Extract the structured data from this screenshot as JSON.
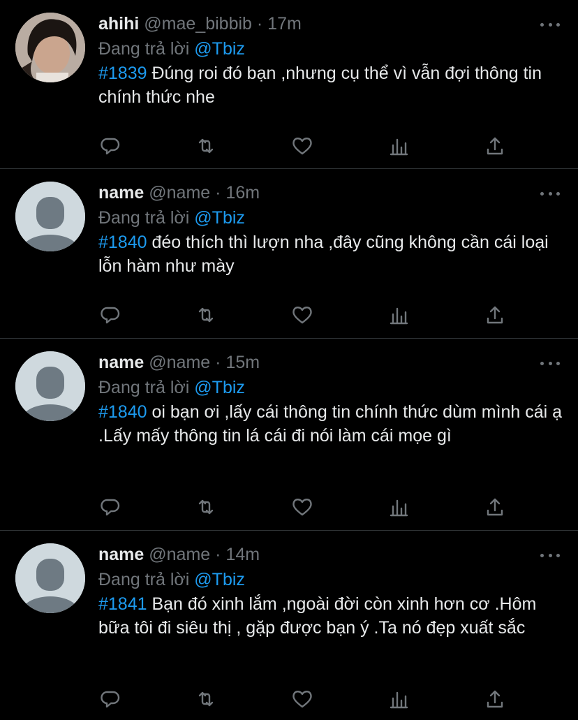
{
  "colors": {
    "background": "#000000",
    "text": "#e7e9ea",
    "muted": "#71767b",
    "accent": "#1d9bf0",
    "divider": "#2f3336"
  },
  "tweets": [
    {
      "name": "ahihi",
      "handle": "@mae_bibbib",
      "separator": "·",
      "time": "17m",
      "replying_prefix": "Đang trả lời",
      "replying_to": "@Tbiz",
      "hashtag": "#1839",
      "text": " Đúng roi đó bạn ,nhưng cụ thể vì vẫn đợi thông tin chính thức nhe",
      "avatar": "photo",
      "icons": [
        "reply-icon",
        "retweet-icon",
        "like-icon",
        "analytics-icon",
        "share-icon"
      ]
    },
    {
      "name": "name",
      "handle": "@name",
      "separator": "·",
      "time": "16m",
      "replying_prefix": "Đang trả lời",
      "replying_to": "@Tbiz",
      "hashtag": "#1840",
      "text": " đéo thích thì lượn nha ,đây cũng không cần cái loại lỗn hàm như mày",
      "avatar": "default",
      "icons": [
        "reply-icon",
        "retweet-icon",
        "like-icon",
        "analytics-icon",
        "share-icon"
      ]
    },
    {
      "name": "name",
      "handle": "@name",
      "separator": "·",
      "time": "15m",
      "replying_prefix": "Đang trả lời",
      "replying_to": "@Tbiz",
      "hashtag": "#1840",
      "text": " oi bạn ơi ,lấy cái thông tin chính thức dùm mình cái ạ .Lấy mấy thông tin lá cái đi nói làm cái mọe gì",
      "avatar": "default",
      "icons": [
        "reply-icon",
        "retweet-icon",
        "like-icon",
        "analytics-icon",
        "share-icon"
      ]
    },
    {
      "name": "name",
      "handle": "@name",
      "separator": "·",
      "time": "14m",
      "replying_prefix": "Đang trả lời",
      "replying_to": "@Tbiz",
      "hashtag": "#1841",
      "text": " Bạn đó xinh lắm ,ngoài đời còn xinh hơn cơ .Hôm bữa tôi đi siêu thị , gặp được bạn ý .Ta nó đẹp xuất sắc",
      "avatar": "default",
      "icons": [
        "reply-icon",
        "retweet-icon",
        "like-icon",
        "analytics-icon",
        "share-icon"
      ]
    }
  ]
}
